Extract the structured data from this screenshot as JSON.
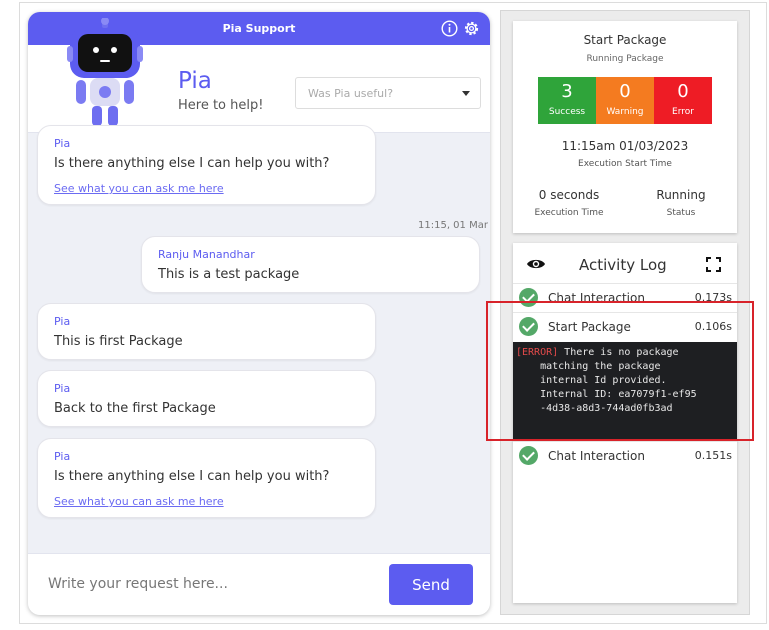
{
  "chat": {
    "header_title": "Pia Support",
    "bot_name": "Pia",
    "bot_tagline": "Here to help!",
    "feedback_placeholder": "Was Pia useful?",
    "messages": [
      {
        "sender": "Pia",
        "text": "Is there anything else I can help you with?",
        "link": "See what you can ask me here"
      },
      {
        "timestamp": "11:15, 01 Mar"
      },
      {
        "sender": "Ranju Manandhar",
        "text": "This is a test package"
      },
      {
        "sender": "Pia",
        "text": "This is first Package"
      },
      {
        "sender": "Pia",
        "text": "Back to the first Package"
      },
      {
        "sender": "Pia",
        "text": "Is there anything else I can help you with?",
        "link": "See what you can ask me here"
      }
    ],
    "input_placeholder": "Write your request here...",
    "send_label": "Send"
  },
  "package": {
    "title": "Start Package",
    "subtitle": "Running Package",
    "stats": [
      {
        "value": "3",
        "label": "Success",
        "color": "#2fa43a"
      },
      {
        "value": "0",
        "label": "Warning",
        "color": "#f47b20"
      },
      {
        "value": "0",
        "label": "Error",
        "color": "#ee1c25"
      }
    ],
    "start_time": "11:15am 01/03/2023",
    "start_time_label": "Execution Start Time",
    "exec_time": "0 seconds",
    "exec_time_label": "Execution Time",
    "status": "Running",
    "status_label": "Status"
  },
  "activity_log": {
    "title": "Activity Log",
    "rows": [
      {
        "name": "Chat Interaction",
        "time": "0.173s"
      },
      {
        "name": "Start Package",
        "time": "0.106s"
      },
      {
        "name": "Chat Interaction",
        "time": "0.151s"
      }
    ],
    "error_tag": "[ERROR]",
    "error_message": " There is no package\n    matching the package\n    internal Id provided.\n    Internal ID: ea7079f1-ef95\n    -4d38-a8d3-744ad0fb3ad"
  },
  "colors": {
    "accent": "#5c5cf0",
    "check": "#54a868",
    "highlight": "#d8232a"
  },
  "icons": [
    "info-icon",
    "settings-icon",
    "robot-avatar",
    "chevron-down-icon",
    "eye-icon",
    "fullscreen-icon",
    "check-circle-icon"
  ]
}
